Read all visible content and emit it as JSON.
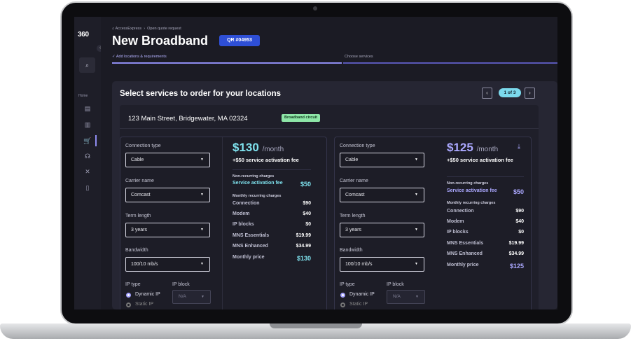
{
  "sidebar": {
    "logo": "360",
    "collapse_glyph": "‹",
    "search_glyph": "⌕",
    "home_label": "Home",
    "nav_icons": [
      "archive-icon",
      "building-icon",
      "cart-icon",
      "voice-icon",
      "tools-icon",
      "mobile-icon"
    ],
    "nav_glyphs": [
      "▤",
      "▥",
      "🛒",
      "☊",
      "✕",
      "▯"
    ]
  },
  "breadcrumb": {
    "home_glyph": "⌂",
    "root": "AccessExpress",
    "sep": "›",
    "current": "Open quote request"
  },
  "header": {
    "title": "New Broadband",
    "qr_badge": "QR #04953"
  },
  "steps": [
    {
      "label": "Add locations & requirements",
      "check": "✓"
    },
    {
      "label": "Choose services"
    }
  ],
  "panel": {
    "title": "Select services to order for your locations",
    "pager": {
      "prev": "‹",
      "page": "1 of 3",
      "next": "›"
    }
  },
  "location": {
    "address": "123 Main Street, Bridgewater, MA 02324",
    "badge": "Broadband circuit"
  },
  "labels": {
    "connection_type": "Connection type",
    "carrier_name": "Carrier name",
    "term_length": "Term length",
    "bandwidth": "Bandwidth",
    "ip_type": "IP type",
    "ip_block": "IP block",
    "dynamic_ip": "Dynamic IP",
    "static_ip": "Static IP",
    "non_recurring": "Non-recurring charges",
    "monthly_recurring": "Monthly recurring charges",
    "per_month": "/month",
    "chevron": "▼"
  },
  "offers": [
    {
      "connection_type": "Cable",
      "carrier": "Comcast",
      "term": "3 years",
      "bandwidth": "100/10 mb/s",
      "ip_block": "N/A",
      "price": "$130",
      "activation": "+$50 service activation fee",
      "nrc": [
        {
          "k": "Service activation fee",
          "v": "$50"
        }
      ],
      "mrc": [
        {
          "k": "Connection",
          "v": "$90"
        },
        {
          "k": "Modem",
          "v": "$40"
        },
        {
          "k": "IP blocks",
          "v": "$0"
        },
        {
          "k": "MNS Essentials",
          "v": "$19.99"
        },
        {
          "k": "MNS Enhanced",
          "v": "$34.99"
        }
      ],
      "monthly_total": {
        "k": "Monthly price",
        "v": "$130"
      }
    },
    {
      "connection_type": "Cable",
      "carrier": "Comcast",
      "term": "3 years",
      "bandwidth": "100/10 mb/s",
      "ip_block": "N/A",
      "price": "$125",
      "activation": "+$50 service activation fee",
      "download_glyph": "⤓",
      "nrc": [
        {
          "k": "Service activation fee",
          "v": "$50"
        }
      ],
      "mrc": [
        {
          "k": "Connection",
          "v": "$90"
        },
        {
          "k": "Modem",
          "v": "$40"
        },
        {
          "k": "IP blocks",
          "v": "$0"
        },
        {
          "k": "MNS Essentials",
          "v": "$19.99"
        },
        {
          "k": "MNS Enhanced",
          "v": "$34.99"
        }
      ],
      "monthly_total": {
        "k": "Monthly price",
        "v": "$125"
      }
    }
  ],
  "colors": {
    "accent_cyan": "#7fe3ef",
    "accent_purple": "#aba8ff",
    "badge_blue": "#2e4fd6",
    "badge_green": "#8ee6a8"
  }
}
